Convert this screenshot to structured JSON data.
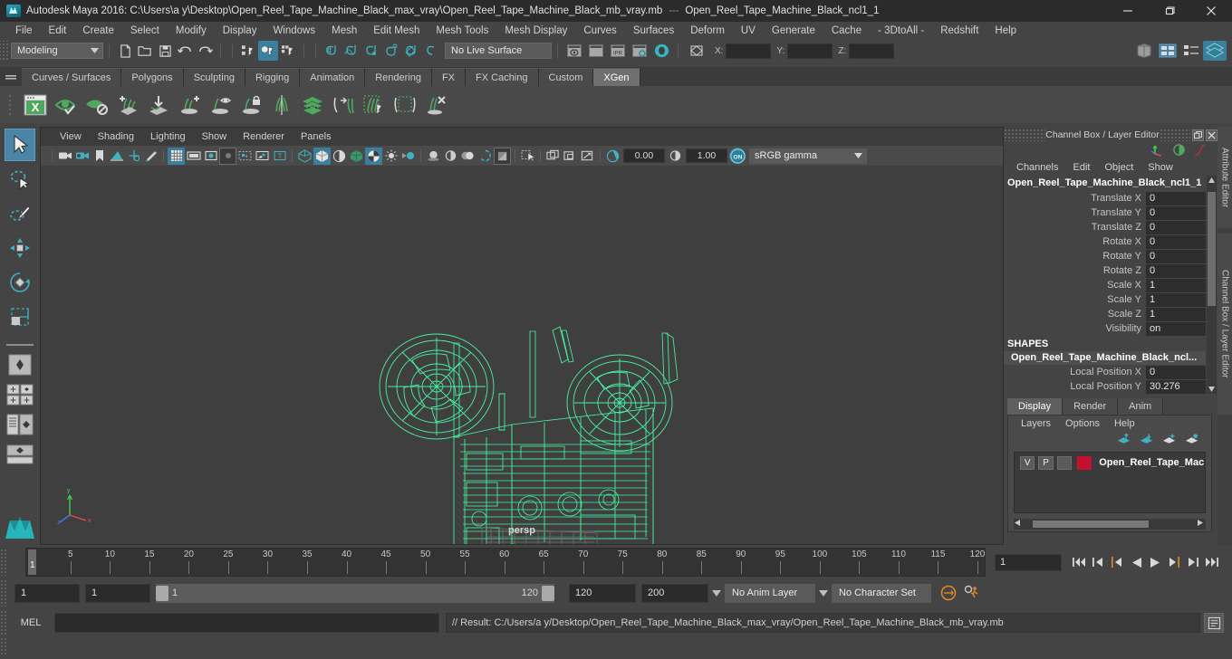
{
  "titlebar": {
    "app_title": "Autodesk Maya 2016: C:\\Users\\a y\\Desktop\\Open_Reel_Tape_Machine_Black_max_vray\\Open_Reel_Tape_Machine_Black_mb_vray.mb",
    "separator": "---",
    "scene_node": "Open_Reel_Tape_Machine_Black_ncl1_1",
    "minimize": "minimize-icon",
    "maximize": "maximize-icon",
    "close": "close-icon"
  },
  "menubar": {
    "items": [
      {
        "label": "File"
      },
      {
        "label": "Edit"
      },
      {
        "label": "Create"
      },
      {
        "label": "Select"
      },
      {
        "label": "Modify"
      },
      {
        "label": "Display"
      },
      {
        "label": "Windows"
      },
      {
        "label": "Mesh"
      },
      {
        "label": "Edit Mesh"
      },
      {
        "label": "Mesh Tools"
      },
      {
        "label": "Mesh Display"
      },
      {
        "label": "Curves"
      },
      {
        "label": "Surfaces"
      },
      {
        "label": "Deform"
      },
      {
        "label": "UV"
      },
      {
        "label": "Generate"
      },
      {
        "label": "Cache"
      },
      {
        "label": "- 3DtoAll -"
      },
      {
        "label": "Redshift"
      },
      {
        "label": "Help"
      }
    ]
  },
  "statusbar": {
    "menu_set": "Modeling",
    "live_surface": "No Live Surface",
    "x_label": "X:",
    "y_label": "Y:",
    "z_label": "Z:",
    "x_value": "",
    "y_value": "",
    "z_value": "",
    "ipr_label": "IPR"
  },
  "shelf": {
    "tabs": [
      {
        "label": "Curves / Surfaces",
        "active": false
      },
      {
        "label": "Polygons",
        "active": false
      },
      {
        "label": "Sculpting",
        "active": false
      },
      {
        "label": "Rigging",
        "active": false
      },
      {
        "label": "Animation",
        "active": false
      },
      {
        "label": "Rendering",
        "active": false
      },
      {
        "label": "FX",
        "active": false
      },
      {
        "label": "FX Caching",
        "active": false
      },
      {
        "label": "Custom",
        "active": false
      },
      {
        "label": "XGen",
        "active": true
      }
    ],
    "icons": [
      "xgen-window-icon",
      "preview-on-icon",
      "preview-off-icon",
      "add-description-icon",
      "import-collection-icon",
      "add-guide-icon",
      "guide-visibility-icon",
      "lock-guide-icon",
      "mirror-guides-icon",
      "layers-icon",
      "convert-to-polygons-icon",
      "select-region-icon",
      "clip-region-icon",
      "delete-guide-icon"
    ]
  },
  "toolbox": {
    "tools": [
      {
        "name": "select-tool",
        "selected": true
      },
      {
        "name": "lasso-select-tool",
        "selected": false
      },
      {
        "name": "paint-select-tool",
        "selected": false
      },
      {
        "name": "move-tool",
        "selected": false
      },
      {
        "name": "rotate-tool",
        "selected": false
      },
      {
        "name": "scale-tool",
        "selected": false
      }
    ],
    "layouts": [
      {
        "name": "single-perspective-layout"
      },
      {
        "name": "four-view-layout"
      },
      {
        "name": "outliner-persp-layout"
      },
      {
        "name": "persp-graph-layout"
      }
    ]
  },
  "viewport": {
    "menus": [
      {
        "label": "View"
      },
      {
        "label": "Shading"
      },
      {
        "label": "Lighting"
      },
      {
        "label": "Show"
      },
      {
        "label": "Renderer"
      },
      {
        "label": "Panels"
      }
    ],
    "exposure_value": "0.00",
    "gamma_value": "1.00",
    "color_profile": "sRGB gamma",
    "color_management_toggle": "ON",
    "camera_label": "persp",
    "model_description": "Open reel tape machine wireframe shaded in green"
  },
  "channelbox": {
    "panel_title": "Channel Box / Layer Editor",
    "menus": [
      {
        "label": "Channels"
      },
      {
        "label": "Edit"
      },
      {
        "label": "Object"
      },
      {
        "label": "Show"
      }
    ],
    "object_name": "Open_Reel_Tape_Machine_Black_ncl1_1",
    "transform_channels": [
      {
        "label": "Translate X",
        "value": "0"
      },
      {
        "label": "Translate Y",
        "value": "0"
      },
      {
        "label": "Translate Z",
        "value": "0"
      },
      {
        "label": "Rotate X",
        "value": "0"
      },
      {
        "label": "Rotate Y",
        "value": "0"
      },
      {
        "label": "Rotate Z",
        "value": "0"
      },
      {
        "label": "Scale X",
        "value": "1"
      },
      {
        "label": "Scale Y",
        "value": "1"
      },
      {
        "label": "Scale Z",
        "value": "1"
      },
      {
        "label": "Visibility",
        "value": "on"
      }
    ],
    "shapes_header": "SHAPES",
    "shape_name": "Open_Reel_Tape_Machine_Black_ncl...",
    "shape_channels": [
      {
        "label": "Local Position X",
        "value": "0"
      },
      {
        "label": "Local Position Y",
        "value": "30.276"
      }
    ]
  },
  "layereditor": {
    "tabs": [
      {
        "label": "Display",
        "active": true
      },
      {
        "label": "Render",
        "active": false
      },
      {
        "label": "Anim",
        "active": false
      }
    ],
    "menus": [
      {
        "label": "Layers"
      },
      {
        "label": "Options"
      },
      {
        "label": "Help"
      }
    ],
    "tool_icons": [
      "move-layer-up-icon",
      "move-layer-down-icon",
      "new-layer-icon",
      "new-layer-from-selected-icon"
    ],
    "layers": [
      {
        "visibility": "V",
        "playback": "P",
        "shading": "",
        "color": "#c4102e",
        "name": "Open_Reel_Tape_Machir"
      }
    ]
  },
  "side_tabs": [
    {
      "label": "Attribute Editor"
    },
    {
      "label": "Channel Box / Layer Editor"
    }
  ],
  "timeline": {
    "start": 1,
    "end": 120,
    "current_frame": "1",
    "tick_labels": [
      5,
      10,
      15,
      20,
      25,
      30,
      35,
      40,
      45,
      50,
      55,
      60,
      65,
      70,
      75,
      80,
      85,
      90,
      95,
      100,
      105,
      110,
      115,
      120
    ],
    "current_frame_marker": "1",
    "playback_buttons": [
      "go-to-start-icon",
      "step-back-keyframe-icon",
      "step-back-frame-icon",
      "play-backwards-icon",
      "play-forwards-icon",
      "step-forward-frame-icon",
      "step-forward-keyframe-icon",
      "go-to-end-icon"
    ]
  },
  "rangeslider": {
    "anim_start": "1",
    "range_start": "1",
    "slider_min": "1",
    "slider_max": "120",
    "range_end": "120",
    "anim_end": "200",
    "anim_layer": "No Anim Layer",
    "character_set": "No Character Set",
    "auto_key_icon": "auto-keyframe-icon",
    "anim_prefs_icon": "animation-preferences-icon"
  },
  "commandline": {
    "language_label": "MEL",
    "input_value": "",
    "result_text": "// Result: C:/Users/a y/Desktop/Open_Reel_Tape_Machine_Black_max_vray/Open_Reel_Tape_Machine_Black_mb_vray.mb",
    "script_editor_icon": "script-editor-icon"
  },
  "colors": {
    "accent_blue": "#3b7f9e",
    "teal_icon": "#3fb2bf",
    "shelf_green": "#5fbd72",
    "model_green": "#47f0a0",
    "layer_red": "#c4102e",
    "orange_marker": "#e08a28"
  }
}
